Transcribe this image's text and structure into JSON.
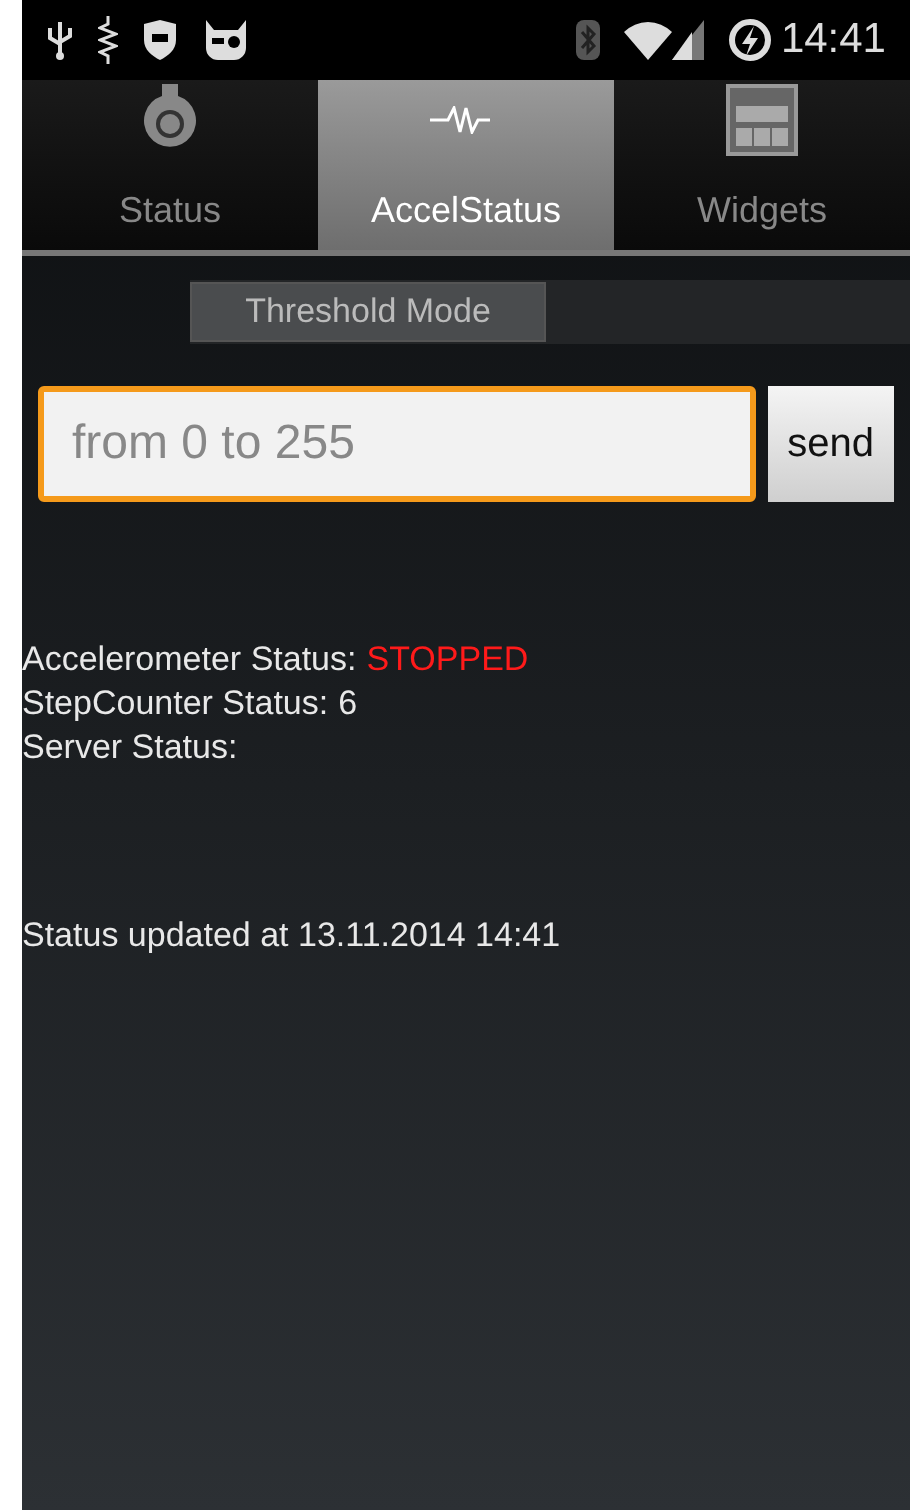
{
  "status_bar": {
    "time": "14:41"
  },
  "tabs": [
    {
      "label": "Status",
      "selected": false
    },
    {
      "label": "AccelStatus",
      "selected": true
    },
    {
      "label": "Widgets",
      "selected": false
    }
  ],
  "mode_switch": {
    "label": "Threshold Mode",
    "on": false
  },
  "threshold_field": {
    "placeholder": "from 0 to 255"
  },
  "send_button": "send",
  "status_lines": [
    {
      "label": "Accelerometer Status:",
      "value": "STOPPED",
      "alert": true
    },
    {
      "label": "StepCounter Status:",
      "value": "6",
      "alert": false
    },
    {
      "label": "Server Status:"
    }
  ],
  "updated": "Status updated at 13.11.2014 14:41"
}
